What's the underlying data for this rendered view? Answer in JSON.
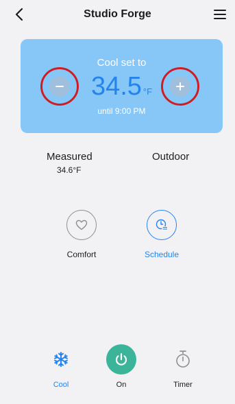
{
  "header": {
    "title": "Studio Forge"
  },
  "setpoint": {
    "mode_caption": "Cool set to",
    "temperature": "34.5",
    "unit": "°F",
    "until": "until 9:00 PM"
  },
  "stats": {
    "measured_label": "Measured",
    "measured_value": "34.6°F",
    "outdoor_label": "Outdoor"
  },
  "modes": {
    "comfort_label": "Comfort",
    "schedule_label": "Schedule"
  },
  "bottom_bar": {
    "cool_label": "Cool",
    "on_label": "On",
    "timer_label": "Timer"
  },
  "colors": {
    "card_background": "#86c7f8",
    "temperature_text": "#2384f0",
    "highlight_ring": "#d01d23",
    "power_button": "#3cb49a",
    "accent_blue": "#2384f0"
  },
  "icons": {
    "back": "chevron-left-icon",
    "menu": "hamburger-menu-icon",
    "minus": "minus-icon",
    "plus": "plus-icon",
    "comfort": "heart-icon",
    "schedule": "schedule-clock-icon",
    "cool": "snowflake-icon",
    "power": "power-icon",
    "timer": "stopwatch-icon"
  }
}
